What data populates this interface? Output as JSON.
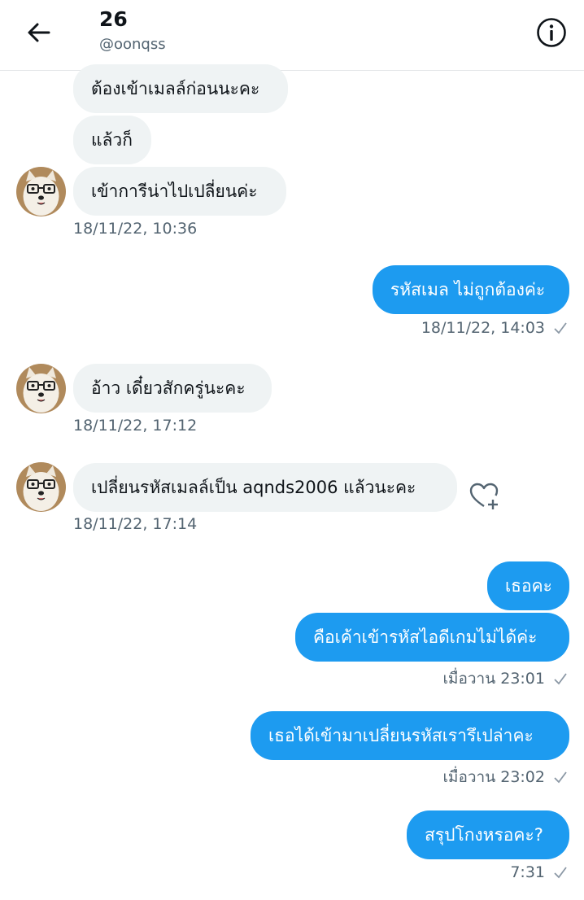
{
  "header": {
    "title": "26",
    "handle": "@oonqss"
  },
  "messages": [
    {
      "side": "in",
      "text": "ต้องเข้าเมลล์ก่อนนะคะ"
    },
    {
      "side": "in",
      "text": "แล้วก็"
    },
    {
      "side": "in",
      "text": "เข้าการีน่าไปเปลี่ยนค่ะ"
    },
    {
      "side": "in",
      "time": "18/11/22, 10:36"
    },
    {
      "side": "out",
      "text": "รหัสเมล ไม่ถูกต้องค่ะ"
    },
    {
      "side": "out",
      "time": "18/11/22, 14:03"
    },
    {
      "side": "in",
      "text": "อ้าว เดี๋ยวสักครู่นะคะ"
    },
    {
      "side": "in",
      "time": "18/11/22, 17:12"
    },
    {
      "side": "in",
      "text": "เปลี่ยนรหัสเมลล์เป็น aqnds2006 แล้วนะคะ"
    },
    {
      "side": "in",
      "time": "18/11/22, 17:14"
    },
    {
      "side": "out",
      "text": "เธอคะ"
    },
    {
      "side": "out",
      "text": "คือเค้าเข้ารหัสไอดีเกมไม่ได้ค่ะ"
    },
    {
      "side": "out",
      "time": "เมื่อวาน 23:01"
    },
    {
      "side": "out",
      "text": "เธอได้เข้ามาเปลี่ยนรหัสเรารึเปล่าคะ"
    },
    {
      "side": "out",
      "time": "เมื่อวาน 23:02"
    },
    {
      "side": "out",
      "text": "สรุปโกงหรอคะ?"
    },
    {
      "side": "out",
      "time": "7:31"
    }
  ],
  "icons": {
    "back": "arrow-left-icon",
    "info": "info-circle-icon",
    "react": "heart-plus-icon",
    "sent": "checkmark-icon",
    "avatar": "dog-avatar-icon"
  },
  "colors": {
    "accent": "#1d9bf0",
    "incoming_bubble": "#eff3f4",
    "meta_text": "#536471"
  }
}
